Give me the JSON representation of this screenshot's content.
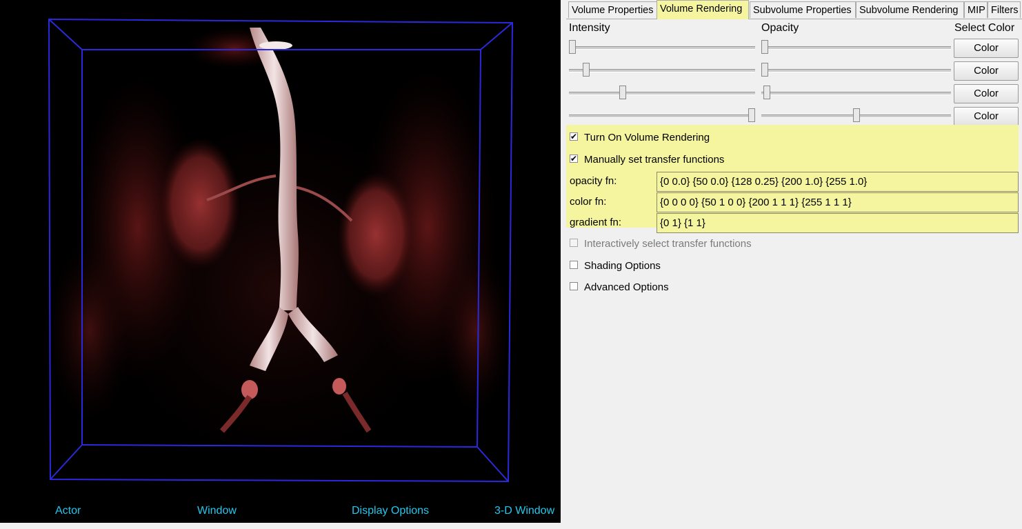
{
  "viewer": {
    "bottom_labels": [
      "Actor",
      "Window",
      "Display Options",
      "3-D Window"
    ]
  },
  "tabs": [
    {
      "label": "Volume Properties",
      "active": false
    },
    {
      "label": "Volume Rendering",
      "active": true
    },
    {
      "label": "Subvolume Properties",
      "active": false
    },
    {
      "label": "Subvolume Rendering",
      "active": false
    },
    {
      "label": "MIP",
      "active": false
    },
    {
      "label": "Filters",
      "active": false
    }
  ],
  "headers": {
    "intensity": "Intensity",
    "opacity": "Opacity",
    "select_color": "Select Color"
  },
  "slider_rows": [
    {
      "intensity_fraction": 0.0,
      "opacity_fraction": 0.0,
      "color_label": "Color"
    },
    {
      "intensity_fraction": 0.075,
      "opacity_fraction": 0.0,
      "color_label": "Color"
    },
    {
      "intensity_fraction": 0.28,
      "opacity_fraction": 0.01,
      "color_label": "Color"
    },
    {
      "intensity_fraction": 1.0,
      "opacity_fraction": 0.5,
      "color_label": "Color"
    }
  ],
  "options": {
    "turn_on_volume_rendering": {
      "label": "Turn On Volume Rendering",
      "checked": true
    },
    "manually_set_transfer_functions": {
      "label": "Manually set transfer functions",
      "checked": true
    },
    "interactively_select": {
      "label": "Interactively select transfer functions",
      "checked": false,
      "disabled": true
    },
    "shading_options": {
      "label": "Shading Options",
      "checked": false
    },
    "advanced_options": {
      "label": "Advanced Options",
      "checked": false
    }
  },
  "transfer_functions": {
    "opacity": {
      "label": "opacity fn:",
      "value": "{0 0.0} {50 0.0} {128 0.25} {200 1.0} {255 1.0}"
    },
    "color": {
      "label": "color fn:",
      "value": "{0 0 0 0} {50 1 0 0} {200 1 1 1} {255 1 1 1}"
    },
    "gradient": {
      "label": "gradient fn:",
      "value": "{0 1} {1 1}"
    }
  },
  "colors": {
    "active_tab": "#f5f5a0",
    "bounding_box": "#2a2adc",
    "bottom_text": "#22c8ee"
  }
}
